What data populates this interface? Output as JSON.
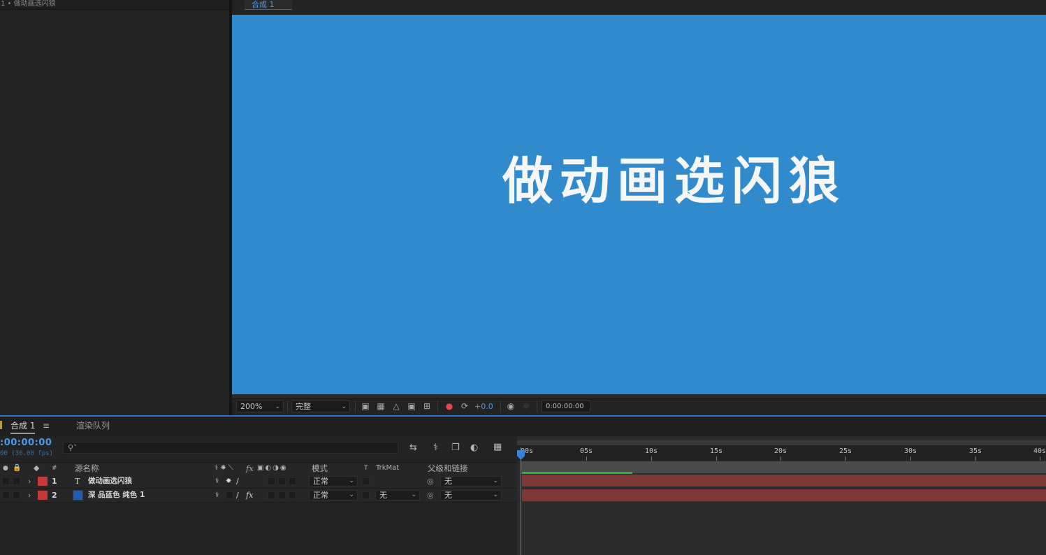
{
  "project": {
    "tab_label": "1 • 做动画选闪狼"
  },
  "viewer": {
    "tab_label": "合成 1",
    "comp_text": "做动画选闪狼",
    "canvas_color": "#318acb",
    "zoom": "200%",
    "resolution": "完整",
    "exposure": "+0.0",
    "timecode": "0:00:00:00"
  },
  "timeline": {
    "tab_comp": "合成 1",
    "tab_render": "渲染队列",
    "current_time": ":00:00:00",
    "fps_text": "00 (30.00 fps)",
    "search_placeholder": "",
    "columns": {
      "num": "#",
      "source_name": "源名称",
      "mode": "模式",
      "t": "T",
      "trkmat": "TrkMat",
      "parent": "父级和链接"
    },
    "layers": [
      {
        "index": "1",
        "type_icon": "T",
        "name": "做动画选闪狼",
        "label_color": "#c23a3a",
        "mode": "正常",
        "trkmat": "",
        "parent": "无"
      },
      {
        "index": "2",
        "type_icon": "■",
        "name": "深 品蓝色 纯色 1",
        "label_color": "#c23a3a",
        "thumb_color": "#1f5fb0",
        "mode": "正常",
        "trkmat": "无",
        "parent": "无"
      }
    ],
    "ruler_ticks": [
      "00s",
      "05s",
      "10s",
      "15s",
      "20s",
      "25s",
      "30s",
      "35s",
      "40s"
    ],
    "layer_bar_color": "#7d3838"
  }
}
